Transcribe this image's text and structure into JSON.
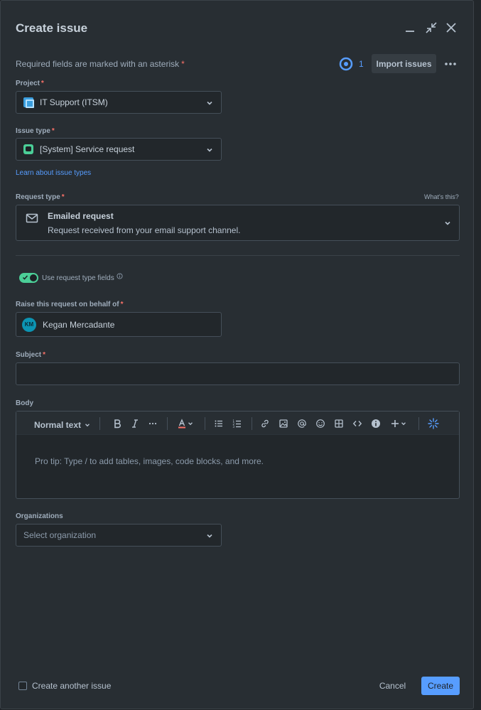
{
  "dialog": {
    "title": "Create issue",
    "required_note": "Required fields are marked with an asterisk",
    "asterisk": "*",
    "watch_count": "1",
    "import_label": "Import issues"
  },
  "fields": {
    "project": {
      "label": "Project",
      "value": "IT Support (ITSM)"
    },
    "issue_type": {
      "label": "Issue type",
      "value": "[System] Service request",
      "help_link": "Learn about issue types"
    },
    "request_type": {
      "label": "Request type",
      "help": "What's this?",
      "value_title": "Emailed request",
      "value_description": "Request received from your email support channel."
    },
    "use_request_type_fields": {
      "label": "Use request type fields",
      "enabled": true
    },
    "on_behalf_of": {
      "label": "Raise this request on behalf of",
      "initials": "KM",
      "value": "Kegan Mercadante"
    },
    "subject": {
      "label": "Subject",
      "value": ""
    },
    "body": {
      "label": "Body",
      "text_style": "Normal text",
      "placeholder": "Pro tip: Type / to add tables, images, code blocks, and more."
    },
    "organizations": {
      "label": "Organizations",
      "placeholder": "Select organization"
    }
  },
  "footer": {
    "create_another": "Create another issue",
    "cancel": "Cancel",
    "create": "Create"
  },
  "colors": {
    "accent": "#579dff",
    "required": "#f87168",
    "toggle_on": "#4bce97",
    "background": "#282e33"
  }
}
